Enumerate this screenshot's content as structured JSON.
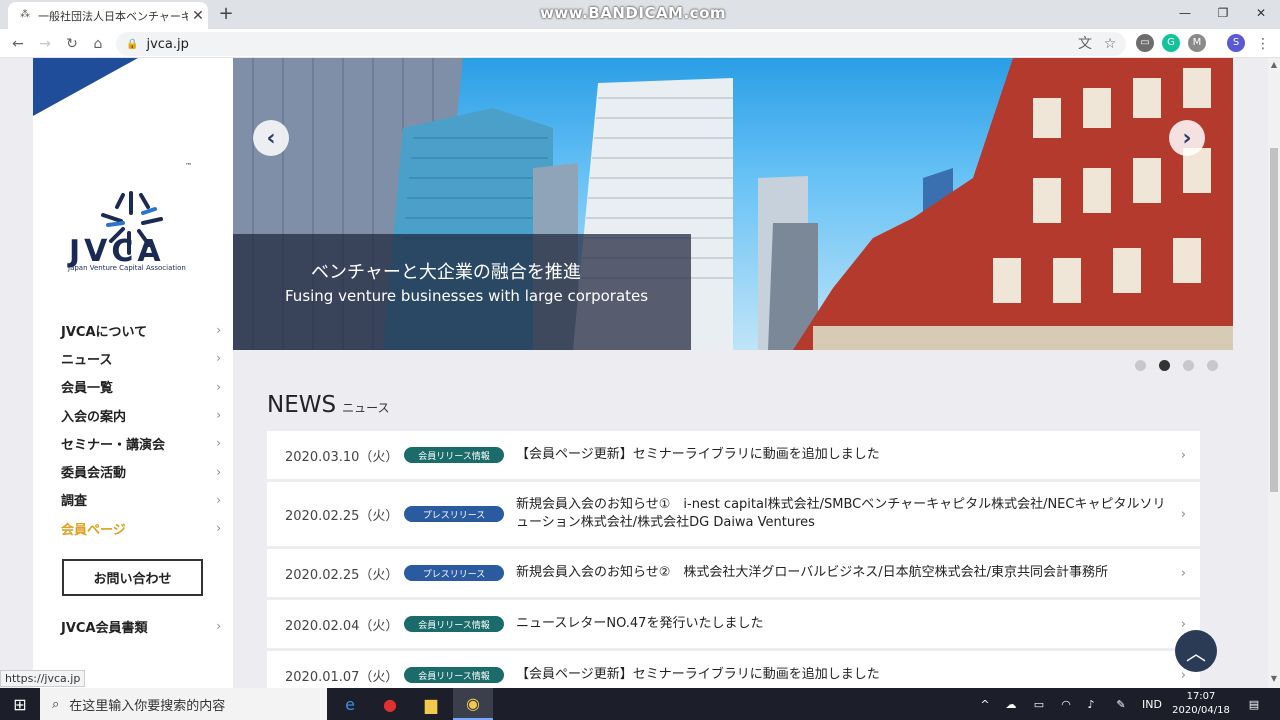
{
  "browser": {
    "tab_title": "一般社団法人日本ベンチャーキ",
    "watermark": "www.BANDICAM.com",
    "url": "jvca.jp",
    "status_url": "https://jvca.jp",
    "profile_initial": "S"
  },
  "logo": {
    "name": "JVCA",
    "subtitle": "Japan Venture Capital Association",
    "tm": "™"
  },
  "nav": {
    "items": [
      {
        "label": "JVCAについて"
      },
      {
        "label": "ニュース"
      },
      {
        "label": "会員一覧"
      },
      {
        "label": "入会の案内"
      },
      {
        "label": "セミナー・講演会"
      },
      {
        "label": "委員会活動"
      },
      {
        "label": "調査"
      },
      {
        "label": "会員ページ"
      }
    ],
    "contact": "お問い合わせ",
    "members_docs": "JVCA会員書類",
    "accent_color": "#e0a020"
  },
  "hero": {
    "title_jp": "ベンチャーと大企業の融合を推進",
    "title_en": "Fusing venture businesses with large corporates",
    "active_slide": 2,
    "slide_count": 4
  },
  "news": {
    "title": "NEWS",
    "subtitle": "ニュース",
    "items": [
      {
        "date": "2020.03.10（火）",
        "badge": "会員リリース情報",
        "badge_type": "member",
        "text": "【会員ページ更新】セミナーライブラリに動画を追加しました"
      },
      {
        "date": "2020.02.25（火）",
        "badge": "プレスリリース",
        "badge_type": "press",
        "text": "新規会員入会のお知らせ①　i-nest capital株式会社/SMBCベンチャーキャピタル株式会社/NECキャピタルソリューション株式会社/株式会社DG Daiwa Ventures"
      },
      {
        "date": "2020.02.25（火）",
        "badge": "プレスリリース",
        "badge_type": "press",
        "text": "新規会員入会のお知らせ②　株式会社大洋グローバルビジネス/日本航空株式会社/東京共同会計事務所"
      },
      {
        "date": "2020.02.04（火）",
        "badge": "会員リリース情報",
        "badge_type": "member",
        "text": "ニュースレターNO.47を発行いたしました"
      },
      {
        "date": "2020.01.07（火）",
        "badge": "会員リリース情報",
        "badge_type": "member",
        "text": "【会員ページ更新】セミナーライブラリに動画を追加しました"
      }
    ]
  },
  "taskbar": {
    "search_placeholder": "在这里输入你要搜索的内容",
    "lang": "IND",
    "time": "17:07",
    "date": "2020/04/18"
  }
}
